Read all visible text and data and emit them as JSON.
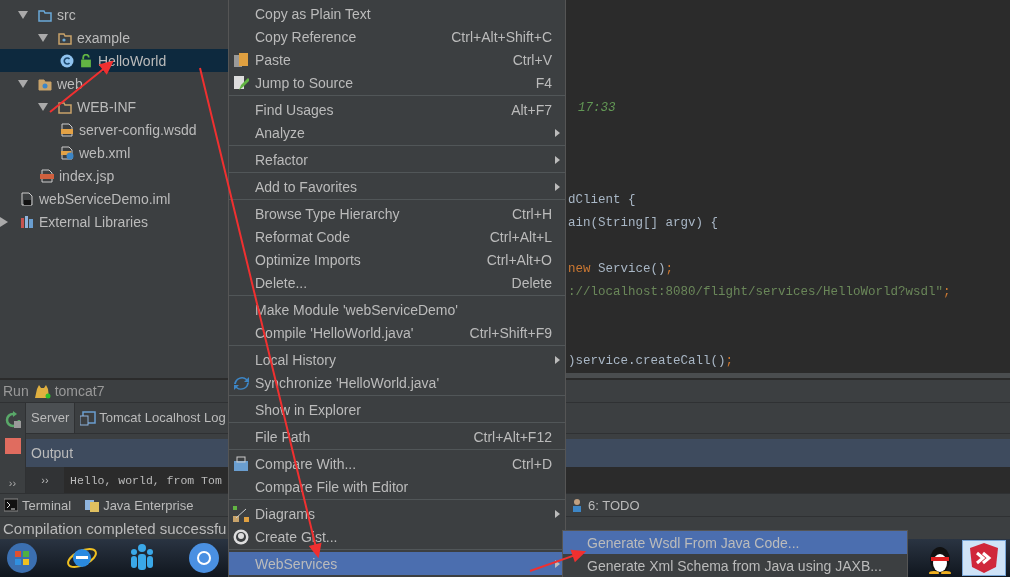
{
  "project_tree": [
    {
      "label": "src",
      "kind": "source-folder",
      "expanded": true,
      "selected": false,
      "children": [
        {
          "label": "example",
          "kind": "package",
          "expanded": true,
          "selected": false,
          "children": [
            {
              "label": "HelloWorld",
              "kind": "class",
              "selected": true
            }
          ]
        }
      ]
    },
    {
      "label": "web",
      "kind": "web-folder",
      "expanded": true,
      "selected": false,
      "children": [
        {
          "label": "WEB-INF",
          "kind": "folder",
          "expanded": true,
          "selected": false,
          "children": [
            {
              "label": "server-config.wsdd",
              "kind": "config-file",
              "selected": false
            },
            {
              "label": "web.xml",
              "kind": "xml-file",
              "selected": false
            }
          ]
        },
        {
          "label": "index.jsp",
          "kind": "jsp-file",
          "selected": false
        }
      ]
    },
    {
      "label": "webServiceDemo.iml",
      "kind": "module-file",
      "selected": false
    },
    {
      "label": "External Libraries",
      "kind": "library",
      "expanded": false,
      "selected": false
    }
  ],
  "editor": {
    "lines": [
      [
        {
          "text": "17:33",
          "kind": "comment"
        }
      ],
      [
        {
          "text": "dClient {",
          "kind": "code"
        }
      ],
      [
        {
          "text": "ain(String[] argv) {",
          "kind": "code"
        }
      ],
      [
        {
          "text": "new",
          "kind": "keyword"
        },
        {
          "text": " Service()",
          "kind": "code"
        },
        {
          "text": ";",
          "kind": "keyword"
        }
      ],
      [
        {
          "text": "://localhost:8080/flight/services/HelloWorld?wsdl\"",
          "kind": "string"
        },
        {
          "text": ";",
          "kind": "keyword"
        }
      ],
      [
        {
          "text": ")service.createCall()",
          "kind": "code"
        },
        {
          "text": ";",
          "kind": "keyword"
        }
      ]
    ]
  },
  "run_panel": {
    "title": "Run",
    "config": "tomcat7",
    "toolbar_more": "››",
    "tabs": [
      {
        "label": "Server",
        "selected": true
      },
      {
        "label": "Tomcat Localhost Log",
        "selected": false
      }
    ],
    "output_header": "Output",
    "console_fold": "››",
    "console_lines": [
      "Hello, world, from Tom"
    ]
  },
  "tool_tabs": [
    {
      "label": "Terminal"
    },
    {
      "label": "Java Enterprise"
    },
    {
      "label": "6: TODO"
    }
  ],
  "status_bar": "Compilation completed successfu",
  "taskbar": [
    {
      "selected": false
    },
    {
      "selected": false
    },
    {
      "selected": false
    },
    {
      "selected": false
    },
    {
      "selected": false
    },
    {
      "selected": true
    }
  ],
  "context_menu": {
    "groups": [
      [
        {
          "label": "Copy as Plain Text",
          "submenu": false,
          "selected": false
        },
        {
          "label": "Copy Reference",
          "shortcut": "Ctrl+Alt+Shift+C",
          "submenu": false,
          "selected": false
        },
        {
          "label": "Paste",
          "shortcut": "Ctrl+V",
          "submenu": false,
          "selected": false
        },
        {
          "label": "Jump to Source",
          "shortcut": "F4",
          "submenu": false,
          "selected": false
        }
      ],
      [
        {
          "label": "Find Usages",
          "shortcut": "Alt+F7",
          "submenu": false,
          "selected": false
        },
        {
          "label": "Analyze",
          "submenu": true,
          "selected": false
        }
      ],
      [
        {
          "label": "Refactor",
          "submenu": true,
          "selected": false
        }
      ],
      [
        {
          "label": "Add to Favorites",
          "submenu": true,
          "selected": false
        }
      ],
      [
        {
          "label": "Browse Type Hierarchy",
          "shortcut": "Ctrl+H",
          "submenu": false,
          "selected": false
        },
        {
          "label": "Reformat Code",
          "shortcut": "Ctrl+Alt+L",
          "submenu": false,
          "selected": false
        },
        {
          "label": "Optimize Imports",
          "shortcut": "Ctrl+Alt+O",
          "submenu": false,
          "selected": false
        },
        {
          "label": "Delete...",
          "shortcut": "Delete",
          "submenu": false,
          "selected": false
        }
      ],
      [
        {
          "label": "Make Module 'webServiceDemo'",
          "submenu": false,
          "selected": false
        },
        {
          "label": "Compile 'HelloWorld.java'",
          "shortcut": "Ctrl+Shift+F9",
          "submenu": false,
          "selected": false
        }
      ],
      [
        {
          "label": "Local History",
          "submenu": true,
          "selected": false
        },
        {
          "label": "Synchronize 'HelloWorld.java'",
          "submenu": false,
          "selected": false
        }
      ],
      [
        {
          "label": "Show in Explorer",
          "submenu": false,
          "selected": false
        }
      ],
      [
        {
          "label": "File Path",
          "shortcut": "Ctrl+Alt+F12",
          "submenu": false,
          "selected": false
        }
      ],
      [
        {
          "label": "Compare With...",
          "shortcut": "Ctrl+D",
          "submenu": false,
          "selected": false
        },
        {
          "label": "Compare File with Editor",
          "submenu": false,
          "selected": false
        }
      ],
      [
        {
          "label": "Diagrams",
          "submenu": true,
          "selected": false
        },
        {
          "label": "Create Gist...",
          "submenu": false,
          "selected": false
        }
      ],
      [
        {
          "label": "WebServices",
          "submenu": true,
          "selected": true
        }
      ]
    ]
  },
  "submenu": [
    {
      "label": "Generate Wsdl From Java Code...",
      "selected": true
    },
    {
      "label": "Generate Xml Schema from Java using JAXB...",
      "selected": false
    }
  ]
}
